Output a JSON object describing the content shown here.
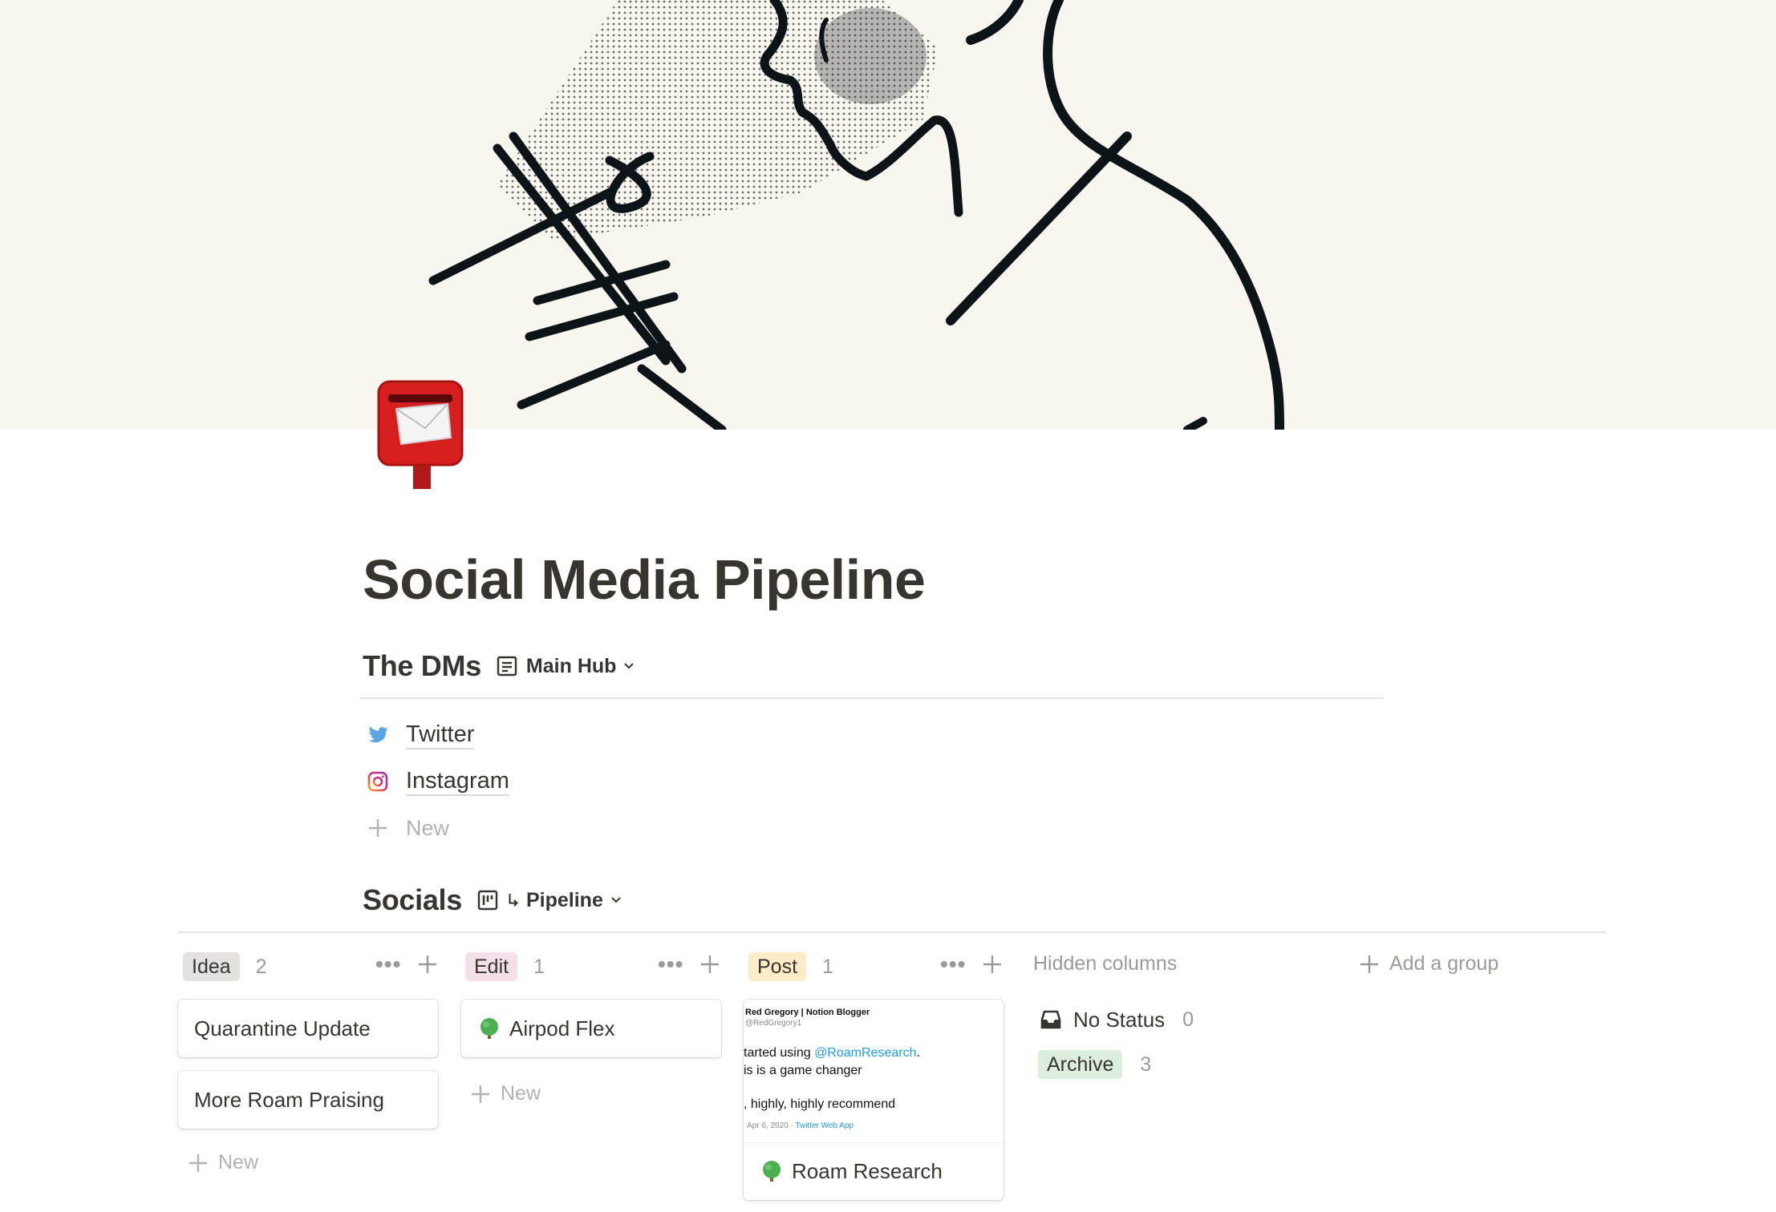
{
  "page": {
    "title": "Social Media Pipeline",
    "icon": "postbox-icon"
  },
  "dms_section": {
    "title": "The DMs",
    "view_icon": "document-icon",
    "view_label": "Main Hub",
    "items": [
      {
        "label": "Twitter",
        "icon": "twitter-icon"
      },
      {
        "label": "Instagram",
        "icon": "instagram-icon"
      }
    ],
    "new_label": "New"
  },
  "socials_section": {
    "title": "Socials",
    "view_icon": "board-icon",
    "view_label": "Pipeline",
    "columns": [
      {
        "tag": "Idea",
        "tag_bg": "#e3e2e0",
        "count": "2",
        "cards": [
          "Quarantine Update",
          "More Roam Praising"
        ],
        "new_label": "New"
      },
      {
        "tag": "Edit",
        "tag_bg": "#f5e0e9",
        "count": "1",
        "cards": [
          "Airpod Flex"
        ],
        "new_label": "New"
      },
      {
        "tag": "Post",
        "tag_bg": "#fdecc8",
        "count": "1",
        "cards": [
          "Roam Research"
        ]
      }
    ],
    "post_preview": {
      "name": "Red Gregory | Notion Blogger",
      "handle": "@RedGregory1",
      "line1_prefix": "tarted using ",
      "line1_link": "@RoamResearch",
      "line1_suffix": ".",
      "line2": "is is a game changer",
      "line3": ", highly, highly recommend",
      "date": "Apr 6, 2020 · ",
      "source": "Twitter Web App"
    },
    "hidden_columns_label": "Hidden columns",
    "add_group_label": "Add a group",
    "hidden": [
      {
        "label": "No Status",
        "count": "0",
        "icon": "inbox-icon"
      },
      {
        "label": "Archive",
        "count": "3",
        "tag_bg": "#dbeddb"
      }
    ]
  },
  "colors": {
    "text": "#37352f",
    "muted": "#9b9a97",
    "cover_bg": "#f9f6f0",
    "twitter": "#1d9bf0"
  }
}
